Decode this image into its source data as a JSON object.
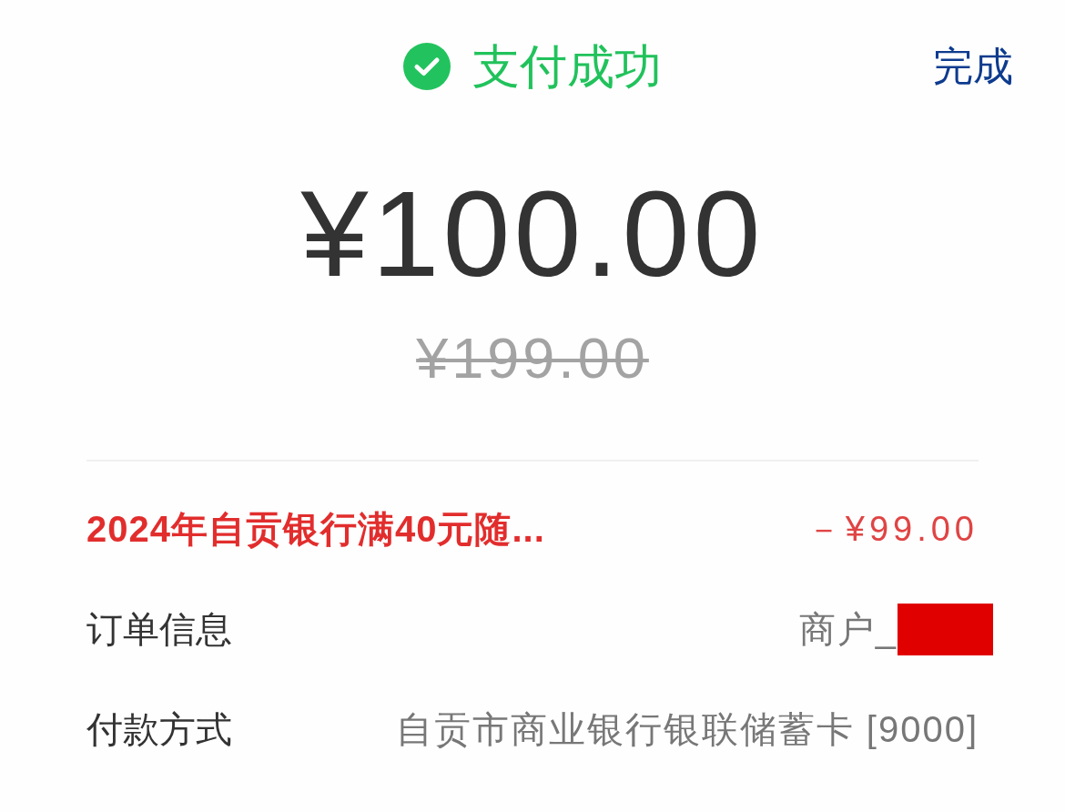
{
  "header": {
    "status": "支付成功",
    "done_button": "完成"
  },
  "amount": {
    "paid": "¥100.00",
    "original": "¥199.00"
  },
  "discount": {
    "name": "2024年自贡银行满40元随...",
    "value": "－¥99.00"
  },
  "details": [
    {
      "label": "订单信息",
      "value": "商户_",
      "redacted": true
    },
    {
      "label": "付款方式",
      "value": "自贡市商业银行银联储蓄卡 [9000]",
      "redacted": false
    }
  ]
}
